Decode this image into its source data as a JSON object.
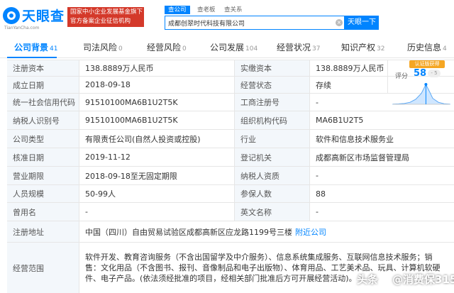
{
  "header": {
    "logo_text": "天眼查",
    "logo_sub": "TianYanCha.com",
    "badge_line1": "国家中小企业发展基金旗下",
    "badge_line2": "官方备案企业征信机构",
    "search_tabs": [
      "查公司",
      "查老板",
      "查关系"
    ],
    "search_value": "成都创翠时代科技有限公司",
    "search_button": "天眼一下"
  },
  "nav": {
    "tabs": [
      {
        "label": "公司背景",
        "count": "41"
      },
      {
        "label": "司法风险",
        "count": "0"
      },
      {
        "label": "经营风险",
        "count": "0"
      },
      {
        "label": "公司发展",
        "count": "104"
      },
      {
        "label": "经营状况",
        "count": "37"
      },
      {
        "label": "知识产权",
        "count": "32"
      },
      {
        "label": "历史信息",
        "count": "4"
      }
    ]
  },
  "score": {
    "tag": "认证版获得",
    "label": "评分",
    "value": "58",
    "pill": "- 5"
  },
  "table": {
    "rows": [
      {
        "l1": "注册资本",
        "v1": "138.8889万人民币",
        "l2": "实缴资本",
        "v2": "138.8889万人民币"
      },
      {
        "l1": "成立日期",
        "v1": "2018-09-18",
        "l2": "经营状态",
        "v2": "存续"
      },
      {
        "l1": "统一社会信用代码",
        "v1": "91510100MA6B1U2T5K",
        "l2": "工商注册号",
        "v2": "-"
      },
      {
        "l1": "纳税人识别号",
        "v1": "91510100MA6B1U2T5K",
        "l2": "组织机构代码",
        "v2": "MA6B1U2T5"
      },
      {
        "l1": "公司类型",
        "v1": "有限责任公司(自然人投资或控股)",
        "l2": "行业",
        "v2": "软件和信息技术服务业"
      },
      {
        "l1": "核准日期",
        "v1": "2019-11-12",
        "l2": "登记机关",
        "v2": "成都高新区市场监督管理局"
      },
      {
        "l1": "营业期限",
        "v1": "2018-09-18至无固定期限",
        "l2": "纳税人资质",
        "v2": "-"
      },
      {
        "l1": "人员规模",
        "v1": "50-99人",
        "l2": "参保人数",
        "v2": "88"
      },
      {
        "l1": "曾用名",
        "v1": "-",
        "l2": "英文名称",
        "v2": "-"
      }
    ],
    "address_label": "注册地址",
    "address_value": "中国（四川）自由贸易试验区成都高新区应龙路1199号三楼",
    "address_link": "附近公司",
    "scope_label": "经营范围",
    "scope_value": "软件开发、教育咨询服务（不含出国留学及中介服务）、信息系统集成服务、互联网信息技术服务；销售：文化用品（不含图书、报刊、音像制品和电子出版物）、体育用品、工艺美术品、玩具、计算机软硬件、电子产品。(依法须经批准的项目，经相关部门批准后方可开展经营活动)。"
  },
  "watermark": {
    "prefix": "头条",
    "at": "@",
    "name": "消费保315"
  },
  "chart_data": {
    "type": "area",
    "x": [
      0,
      10,
      20,
      30,
      40,
      50,
      58,
      65,
      70,
      80,
      90,
      100
    ],
    "y": [
      1,
      2,
      4,
      10,
      25,
      55,
      100,
      60,
      30,
      10,
      3,
      1
    ],
    "highlight_x": 58,
    "xlim": [
      0,
      100
    ],
    "ylim": [
      0,
      100
    ]
  }
}
